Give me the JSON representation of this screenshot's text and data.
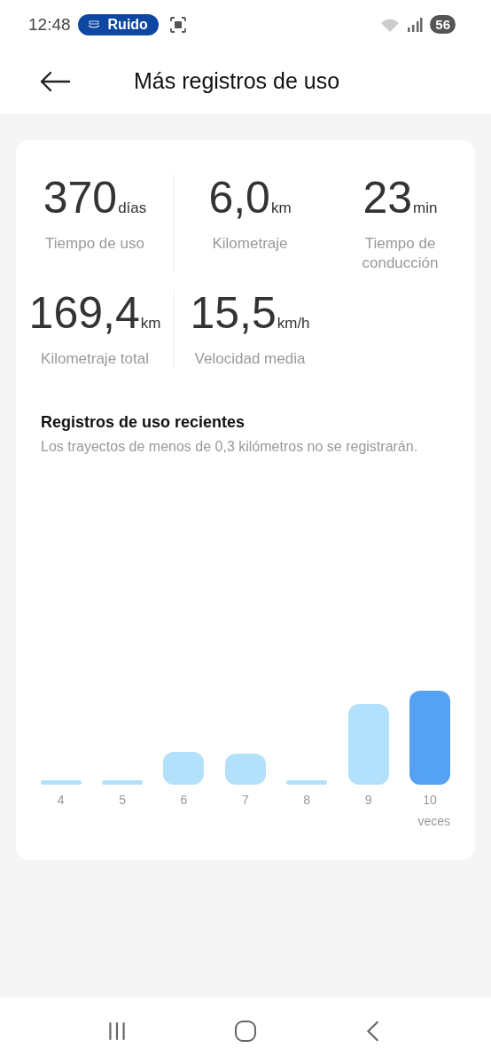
{
  "status_bar": {
    "time": "12:48",
    "pill": "Ruido",
    "battery": "56"
  },
  "header": {
    "title": "Más registros de uso"
  },
  "stats": [
    {
      "value": "370",
      "unit": "días",
      "label": "Tiempo de uso"
    },
    {
      "value": "6,0",
      "unit": "km",
      "label": "Kilometraje"
    },
    {
      "value": "23",
      "unit": "min",
      "label": "Tiempo de conducción"
    },
    {
      "value": "169,4",
      "unit": "km",
      "label": "Kilometraje total"
    },
    {
      "value": "15,5",
      "unit": "km/h",
      "label": "Velocidad media"
    }
  ],
  "recent": {
    "title": "Registros de uso recientes",
    "note": "Los trayectos de menos de 0,3 kilómetros no se registrarán.",
    "bars": [
      {
        "label": "4",
        "selected": false
      },
      {
        "label": "5",
        "selected": false
      },
      {
        "label": "6",
        "selected": false
      },
      {
        "label": "7",
        "selected": false
      },
      {
        "label": "8",
        "selected": false
      },
      {
        "label": "9",
        "selected": false
      },
      {
        "label": "10",
        "selected": true
      }
    ],
    "unit": "veces"
  }
}
